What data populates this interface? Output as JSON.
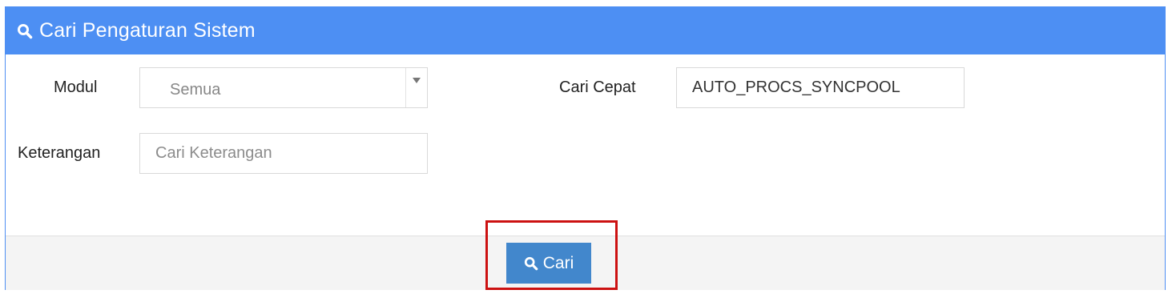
{
  "panel": {
    "title": "Cari Pengaturan Sistem",
    "header_icon": "search-icon",
    "header_color": "#4d8ff3"
  },
  "form": {
    "modul_label": "Modul",
    "modul_value": "Semua",
    "cari_cepat_label": "Cari Cepat",
    "cari_cepat_value": "AUTO_PROCS_SYNCPOOL",
    "keterangan_label": "Keterangan",
    "keterangan_placeholder": "Cari Keterangan",
    "keterangan_value": ""
  },
  "footer": {
    "search_button_label": "Cari",
    "search_button_icon": "search-icon",
    "button_color": "#4287cc",
    "highlight_color": "#cc1111"
  }
}
